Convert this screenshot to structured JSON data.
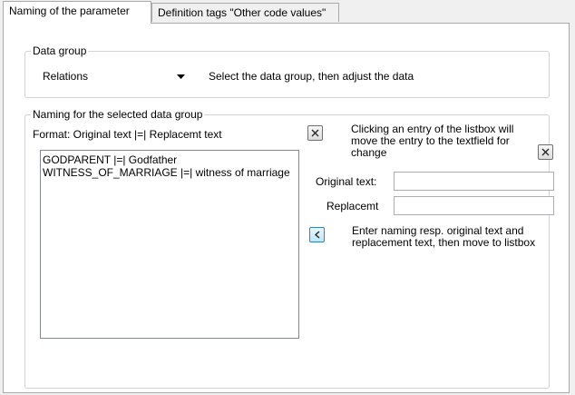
{
  "tabs": [
    {
      "label": "Naming of the parameter"
    },
    {
      "label": "Definition tags \"Other code values\""
    }
  ],
  "data_group": {
    "title": "Data group",
    "select_value": "Relations",
    "hint": "Select the data group, then adjust the data"
  },
  "naming": {
    "title": "Naming for the selected data group",
    "format_label": "Format: Original text |=| Replacemt text",
    "list_items": [
      "GODPARENT |=| Godfather",
      "WITNESS_OF_MARRIAGE |=| witness of marriage"
    ],
    "listbox_hint": "Clicking an entry of the listbox will move the entry to the textfield  for change",
    "original_label": "Original text:",
    "original_value": "",
    "replacement_label": "Replacemt",
    "replacement_value": "",
    "move_hint": "Enter naming resp. original text and replacement text, then move to listbox"
  },
  "icons": {
    "delete_list_entry": "close-icon",
    "clear_fields": "close-icon",
    "move_to_list": "chevron-left-icon",
    "combo_arrow": "caret-down-icon"
  }
}
